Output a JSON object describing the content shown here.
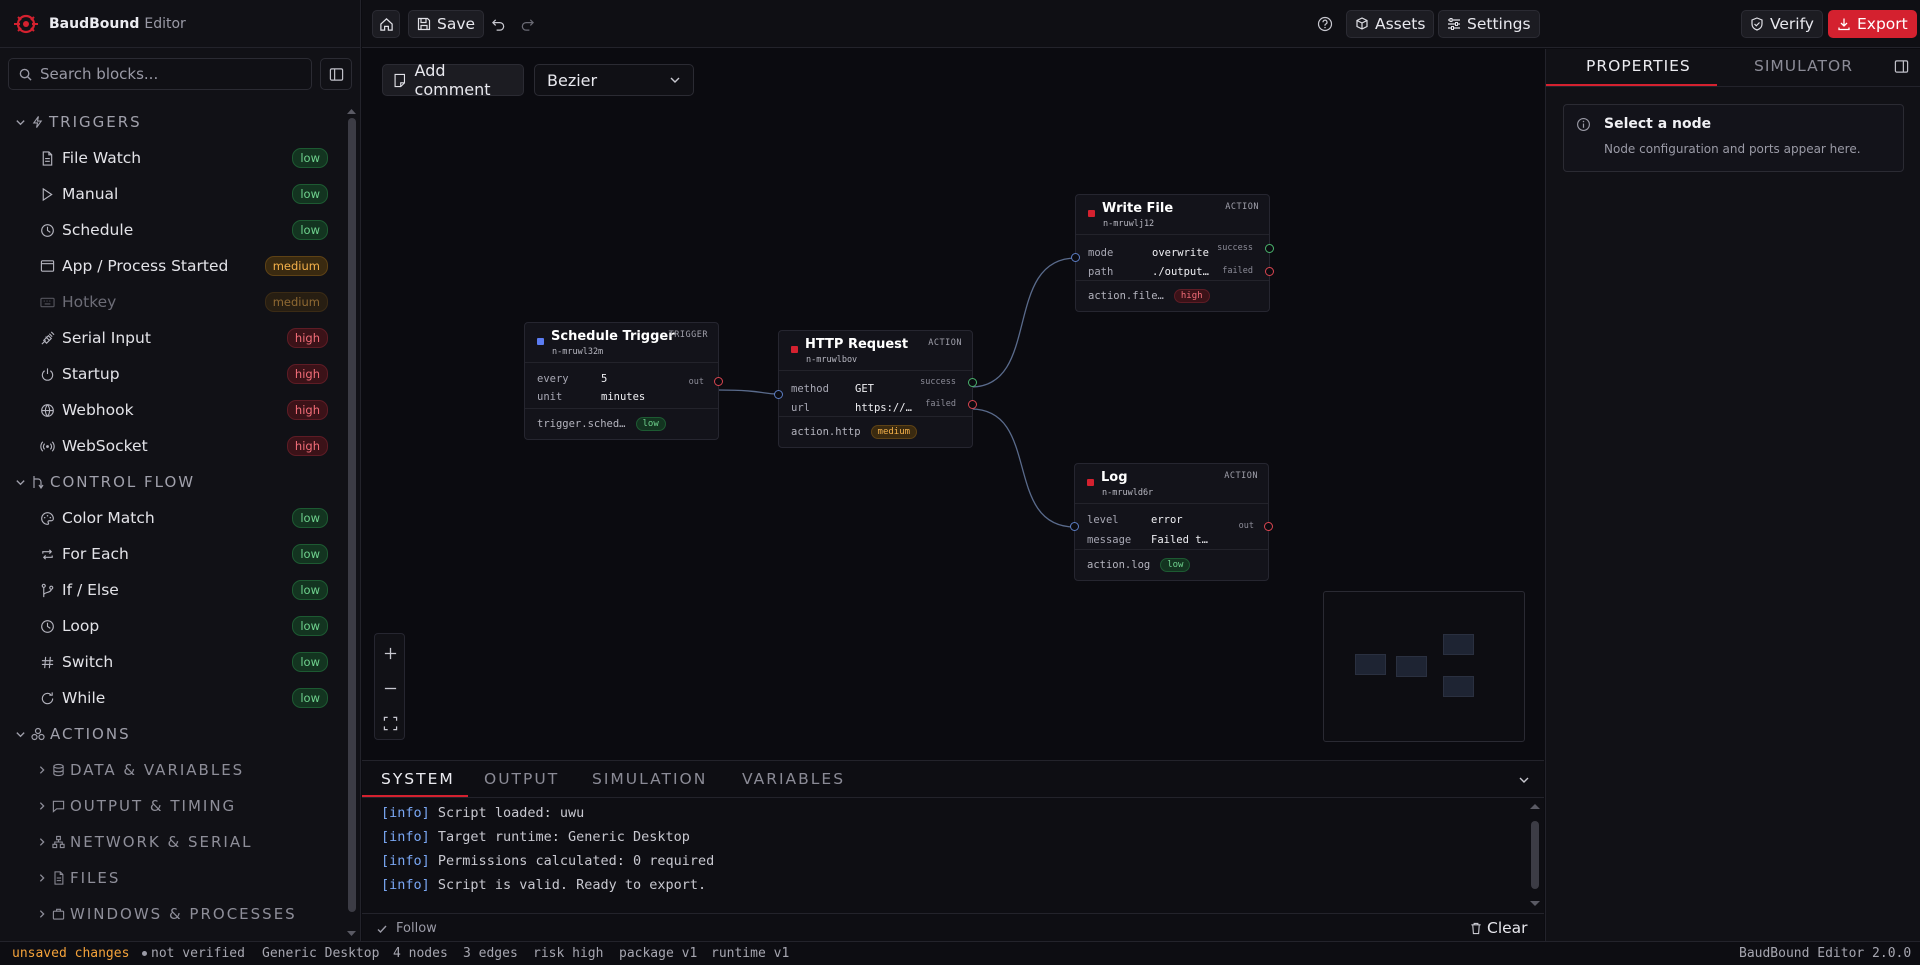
{
  "brand": {
    "name": "BaudBound",
    "suffix": "Editor"
  },
  "search": {
    "placeholder": "Search blocks..."
  },
  "palette": {
    "triggers": {
      "title": "TRIGGERS",
      "items": [
        {
          "label": "File Watch",
          "risk": "low",
          "icon": "file-icon"
        },
        {
          "label": "Manual",
          "risk": "low",
          "icon": "play-icon"
        },
        {
          "label": "Schedule",
          "risk": "low",
          "icon": "clock-icon"
        },
        {
          "label": "App / Process Started",
          "risk": "medium",
          "icon": "window-icon"
        },
        {
          "label": "Hotkey",
          "risk": "medium",
          "icon": "keyboard-icon"
        },
        {
          "label": "Serial Input",
          "risk": "high",
          "icon": "plug-icon"
        },
        {
          "label": "Startup",
          "risk": "high",
          "icon": "power-icon"
        },
        {
          "label": "Webhook",
          "risk": "high",
          "icon": "globe-icon"
        },
        {
          "label": "WebSocket",
          "risk": "high",
          "icon": "radio-icon"
        }
      ]
    },
    "control_flow": {
      "title": "CONTROL FLOW",
      "items": [
        {
          "label": "Color Match",
          "risk": "low",
          "icon": "palette-icon"
        },
        {
          "label": "For Each",
          "risk": "low",
          "icon": "repeat-icon"
        },
        {
          "label": "If / Else",
          "risk": "low",
          "icon": "branch-icon"
        },
        {
          "label": "Loop",
          "risk": "low",
          "icon": "clock-icon"
        },
        {
          "label": "Switch",
          "risk": "low",
          "icon": "hash-icon"
        },
        {
          "label": "While",
          "risk": "low",
          "icon": "refresh-icon"
        }
      ]
    },
    "actions": {
      "title": "ACTIONS",
      "groups": [
        {
          "label": "DATA & VARIABLES",
          "icon": "database-icon"
        },
        {
          "label": "OUTPUT & TIMING",
          "icon": "message-icon"
        },
        {
          "label": "NETWORK & SERIAL",
          "icon": "network-icon"
        },
        {
          "label": "FILES",
          "icon": "file-icon"
        },
        {
          "label": "WINDOWS & PROCESSES",
          "icon": "app-icon"
        }
      ]
    }
  },
  "toolbar": {
    "save": "Save",
    "assets": "Assets",
    "settings": "Settings",
    "verify": "Verify",
    "export": "Export"
  },
  "canvas": {
    "add_comment": "Add comment",
    "edge_style": "Bezier"
  },
  "nodes": {
    "schedule": {
      "title": "Schedule Trigger",
      "id": "n-mruwl32m",
      "type": "TRIGGER",
      "color": "#5b7cf2",
      "fields": [
        {
          "k": "every",
          "v": "5"
        },
        {
          "k": "unit",
          "v": "minutes"
        }
      ],
      "ports_out": [
        "out"
      ],
      "kind": "trigger.sched…",
      "risk": "low"
    },
    "http": {
      "title": "HTTP Request",
      "id": "n-mruwlbov",
      "type": "ACTION",
      "color": "#d4212f",
      "fields": [
        {
          "k": "method",
          "v": "GET"
        },
        {
          "k": "url",
          "v": "https://…"
        }
      ],
      "ports_out": [
        "success",
        "failed"
      ],
      "kind": "action.http",
      "risk": "medium"
    },
    "write": {
      "title": "Write File",
      "id": "n-mruwlj12",
      "type": "ACTION",
      "color": "#d4212f",
      "fields": [
        {
          "k": "mode",
          "v": "overwrite"
        },
        {
          "k": "path",
          "v": "./output…"
        }
      ],
      "ports_out": [
        "success",
        "failed"
      ],
      "kind": "action.file…",
      "risk": "high"
    },
    "log": {
      "title": "Log",
      "id": "n-mruwld6r",
      "type": "ACTION",
      "color": "#d4212f",
      "fields": [
        {
          "k": "level",
          "v": "error"
        },
        {
          "k": "message",
          "v": "Failed t…"
        }
      ],
      "ports_out": [
        "out"
      ],
      "kind": "action.log",
      "risk": "low"
    }
  },
  "bottom": {
    "tabs": [
      "SYSTEM",
      "OUTPUT",
      "SIMULATION",
      "VARIABLES"
    ],
    "active_tab": "SYSTEM",
    "log": [
      {
        "level": "[info]",
        "text": "Script loaded: uwu"
      },
      {
        "level": "[info]",
        "text": "Target runtime: Generic Desktop"
      },
      {
        "level": "[info]",
        "text": "Permissions calculated: 0 required"
      },
      {
        "level": "[info]",
        "text": "Script is valid. Ready to export."
      }
    ],
    "follow": "Follow",
    "clear": "Clear"
  },
  "right": {
    "tabs": [
      "PROPERTIES",
      "SIMULATOR"
    ],
    "active_tab": "PROPERTIES",
    "empty_title": "Select a node",
    "empty_text": "Node configuration and ports appear here."
  },
  "status": {
    "unsaved": "unsaved changes",
    "verified": "not verified",
    "runtime_target": "Generic Desktop",
    "nodes": "4 nodes",
    "edges": "3 edges",
    "risk": "risk high",
    "package": "package v1",
    "runtime": "runtime v1",
    "version": "BaudBound Editor 2.0.0"
  },
  "colors": {
    "accent": "#d4212f",
    "low": "#6fd28e",
    "medium": "#f4b04a",
    "high": "#f26d78",
    "info": "#7aa7f4",
    "unsaved": "#f4a23a"
  }
}
